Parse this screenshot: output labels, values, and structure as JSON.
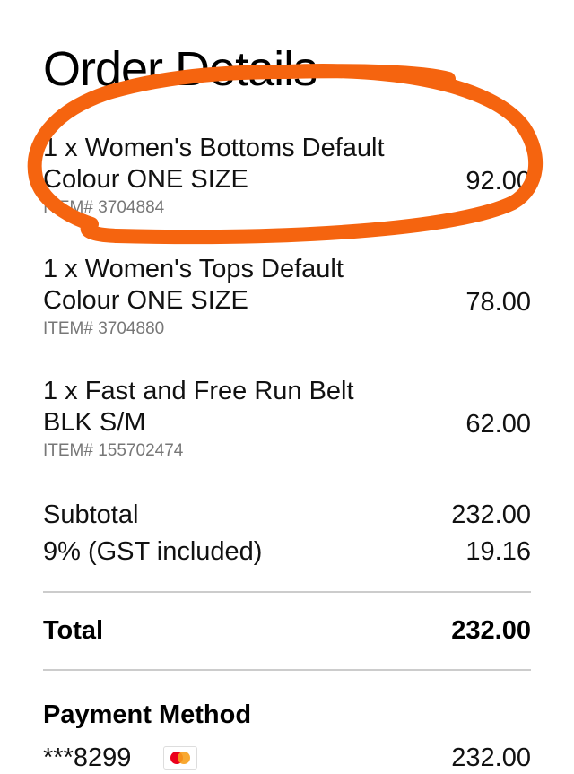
{
  "page": {
    "title": "Order Details"
  },
  "items": [
    {
      "name": "1 x Women's Bottoms Default Colour ONE SIZE",
      "sku": "ITEM# 3704884",
      "price": "92.00"
    },
    {
      "name": "1 x Women's Tops Default Colour ONE SIZE",
      "sku": "ITEM# 3704880",
      "price": "78.00"
    },
    {
      "name": "1 x Fast and Free Run Belt BLK S/M",
      "sku": "ITEM# 155702474",
      "price": "62.00"
    }
  ],
  "summary": {
    "subtotal_label": "Subtotal",
    "subtotal_value": "232.00",
    "tax_label": "9% (GST included)",
    "tax_value": "19.16",
    "total_label": "Total",
    "total_value": "232.00"
  },
  "payment": {
    "heading": "Payment Method",
    "card_mask": "***8299",
    "card_icon": "mastercard-icon",
    "amount": "232.00"
  },
  "colors": {
    "annotation_stroke": "#f5640f",
    "text_primary": "#111111",
    "text_secondary": "#777777",
    "divider": "#cccccc"
  }
}
